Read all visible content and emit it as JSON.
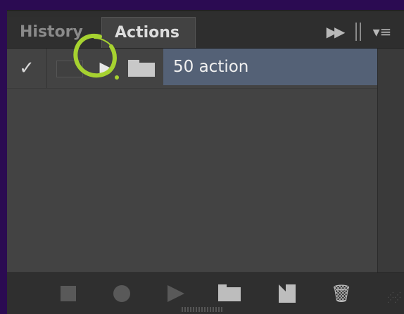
{
  "tabs": [
    {
      "label": "History",
      "active": false
    },
    {
      "label": "Actions",
      "active": true
    }
  ],
  "header": {
    "collapse_icon": "double-chevron-right-icon",
    "menu_icon": "panel-menu-icon",
    "collapse_glyph": "▶▶",
    "menu_glyph": "▾≡"
  },
  "actions": [
    {
      "checked": true,
      "check_glyph": "✓",
      "name": "50 action",
      "type": "set",
      "expanded": false,
      "expand_glyph": "▶",
      "selected": true
    }
  ],
  "toolbar": {
    "buttons": [
      "stop-button",
      "record-button",
      "play-button",
      "new-set-button",
      "new-action-button",
      "delete-button"
    ],
    "trash_glyph": "🗑"
  },
  "colors": {
    "background": "#2b0b52",
    "panel": "#434343",
    "selected_row": "#546176",
    "annotation": "#a6d230"
  }
}
